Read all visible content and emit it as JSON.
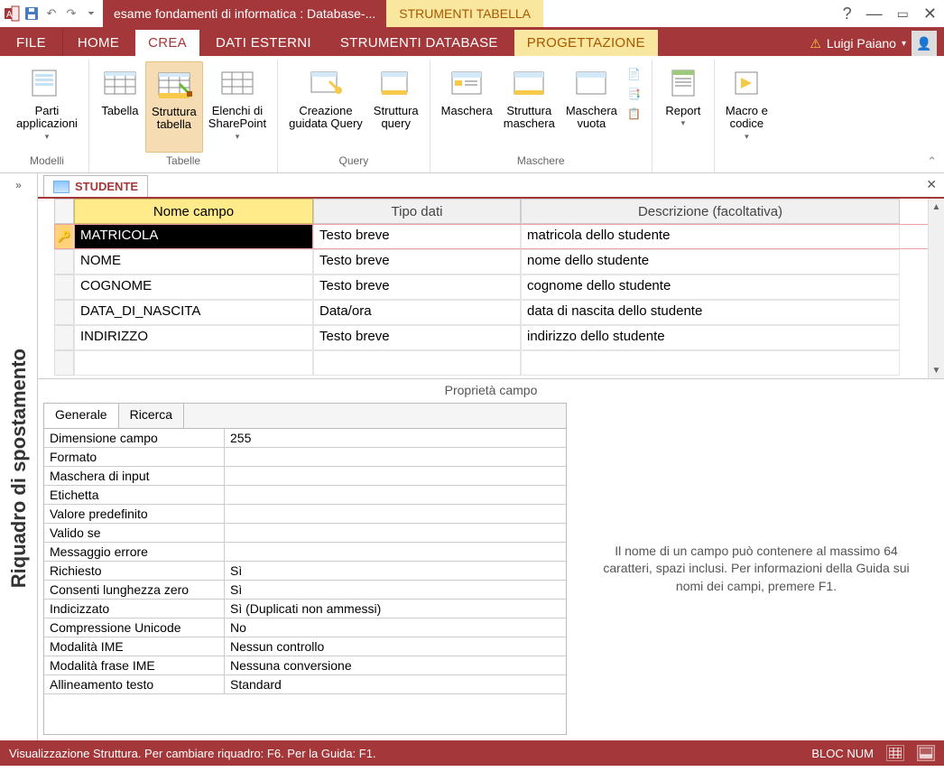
{
  "titlebar": {
    "title_main": "esame fondamenti di informatica : Database-...",
    "title_context": "STRUMENTI TABELLA"
  },
  "tabs": {
    "file": "FILE",
    "home": "HOME",
    "crea": "CREA",
    "dati_esterni": "DATI ESTERNI",
    "strumenti_db": "STRUMENTI DATABASE",
    "progettazione": "PROGETTAZIONE"
  },
  "account": {
    "name": "Luigi Paiano"
  },
  "ribbon": {
    "group_modelli": "Modelli",
    "group_tabelle": "Tabelle",
    "group_query": "Query",
    "group_maschere": "Maschere",
    "parti": "Parti\napplicazioni",
    "tabella": "Tabella",
    "struttura_tabella": "Struttura\ntabella",
    "elenchi": "Elenchi di\nSharePoint",
    "creazione_query": "Creazione\nguidata Query",
    "struttura_query": "Struttura\nquery",
    "maschera": "Maschera",
    "struttura_maschera": "Struttura\nmaschera",
    "maschera_vuota": "Maschera\nvuota",
    "report": "Report",
    "macro": "Macro e\ncodice"
  },
  "navpane_label": "Riquadro di spostamento",
  "doctab": "STUDENTE",
  "grid_headers": {
    "c1": "Nome campo",
    "c2": "Tipo dati",
    "c3": "Descrizione (facoltativa)"
  },
  "fields": [
    {
      "name": "MATRICOLA",
      "type": "Testo breve",
      "desc": "matricola dello studente",
      "pk": true,
      "current": true
    },
    {
      "name": "NOME",
      "type": "Testo breve",
      "desc": "nome dello studente"
    },
    {
      "name": "COGNOME",
      "type": "Testo breve",
      "desc": "cognome dello studente"
    },
    {
      "name": "DATA_DI_NASCITA",
      "type": "Data/ora",
      "desc": "data di nascita dello studente"
    },
    {
      "name": "INDIRIZZO",
      "type": "Testo breve",
      "desc": "indirizzo dello studente"
    }
  ],
  "pane_header": "Proprietà campo",
  "prop_tabs": {
    "generale": "Generale",
    "ricerca": "Ricerca"
  },
  "props": [
    {
      "label": "Dimensione campo",
      "value": "255"
    },
    {
      "label": "Formato",
      "value": ""
    },
    {
      "label": "Maschera di input",
      "value": ""
    },
    {
      "label": "Etichetta",
      "value": ""
    },
    {
      "label": "Valore predefinito",
      "value": ""
    },
    {
      "label": "Valido se",
      "value": ""
    },
    {
      "label": "Messaggio errore",
      "value": ""
    },
    {
      "label": "Richiesto",
      "value": "Sì"
    },
    {
      "label": "Consenti lunghezza zero",
      "value": "Sì"
    },
    {
      "label": "Indicizzato",
      "value": "Sì (Duplicati non ammessi)"
    },
    {
      "label": "Compressione Unicode",
      "value": "No"
    },
    {
      "label": "Modalità IME",
      "value": "Nessun controllo"
    },
    {
      "label": "Modalità frase IME",
      "value": "Nessuna conversione"
    },
    {
      "label": "Allineamento testo",
      "value": "Standard"
    }
  ],
  "help_text": "Il nome di un campo può contenere al massimo 64 caratteri, spazi inclusi. Per informazioni della Guida sui nomi dei campi, premere F1.",
  "status": {
    "left": "Visualizzazione Struttura. Per cambiare riquadro: F6. Per la Guida: F1.",
    "right": "BLOC NUM"
  }
}
